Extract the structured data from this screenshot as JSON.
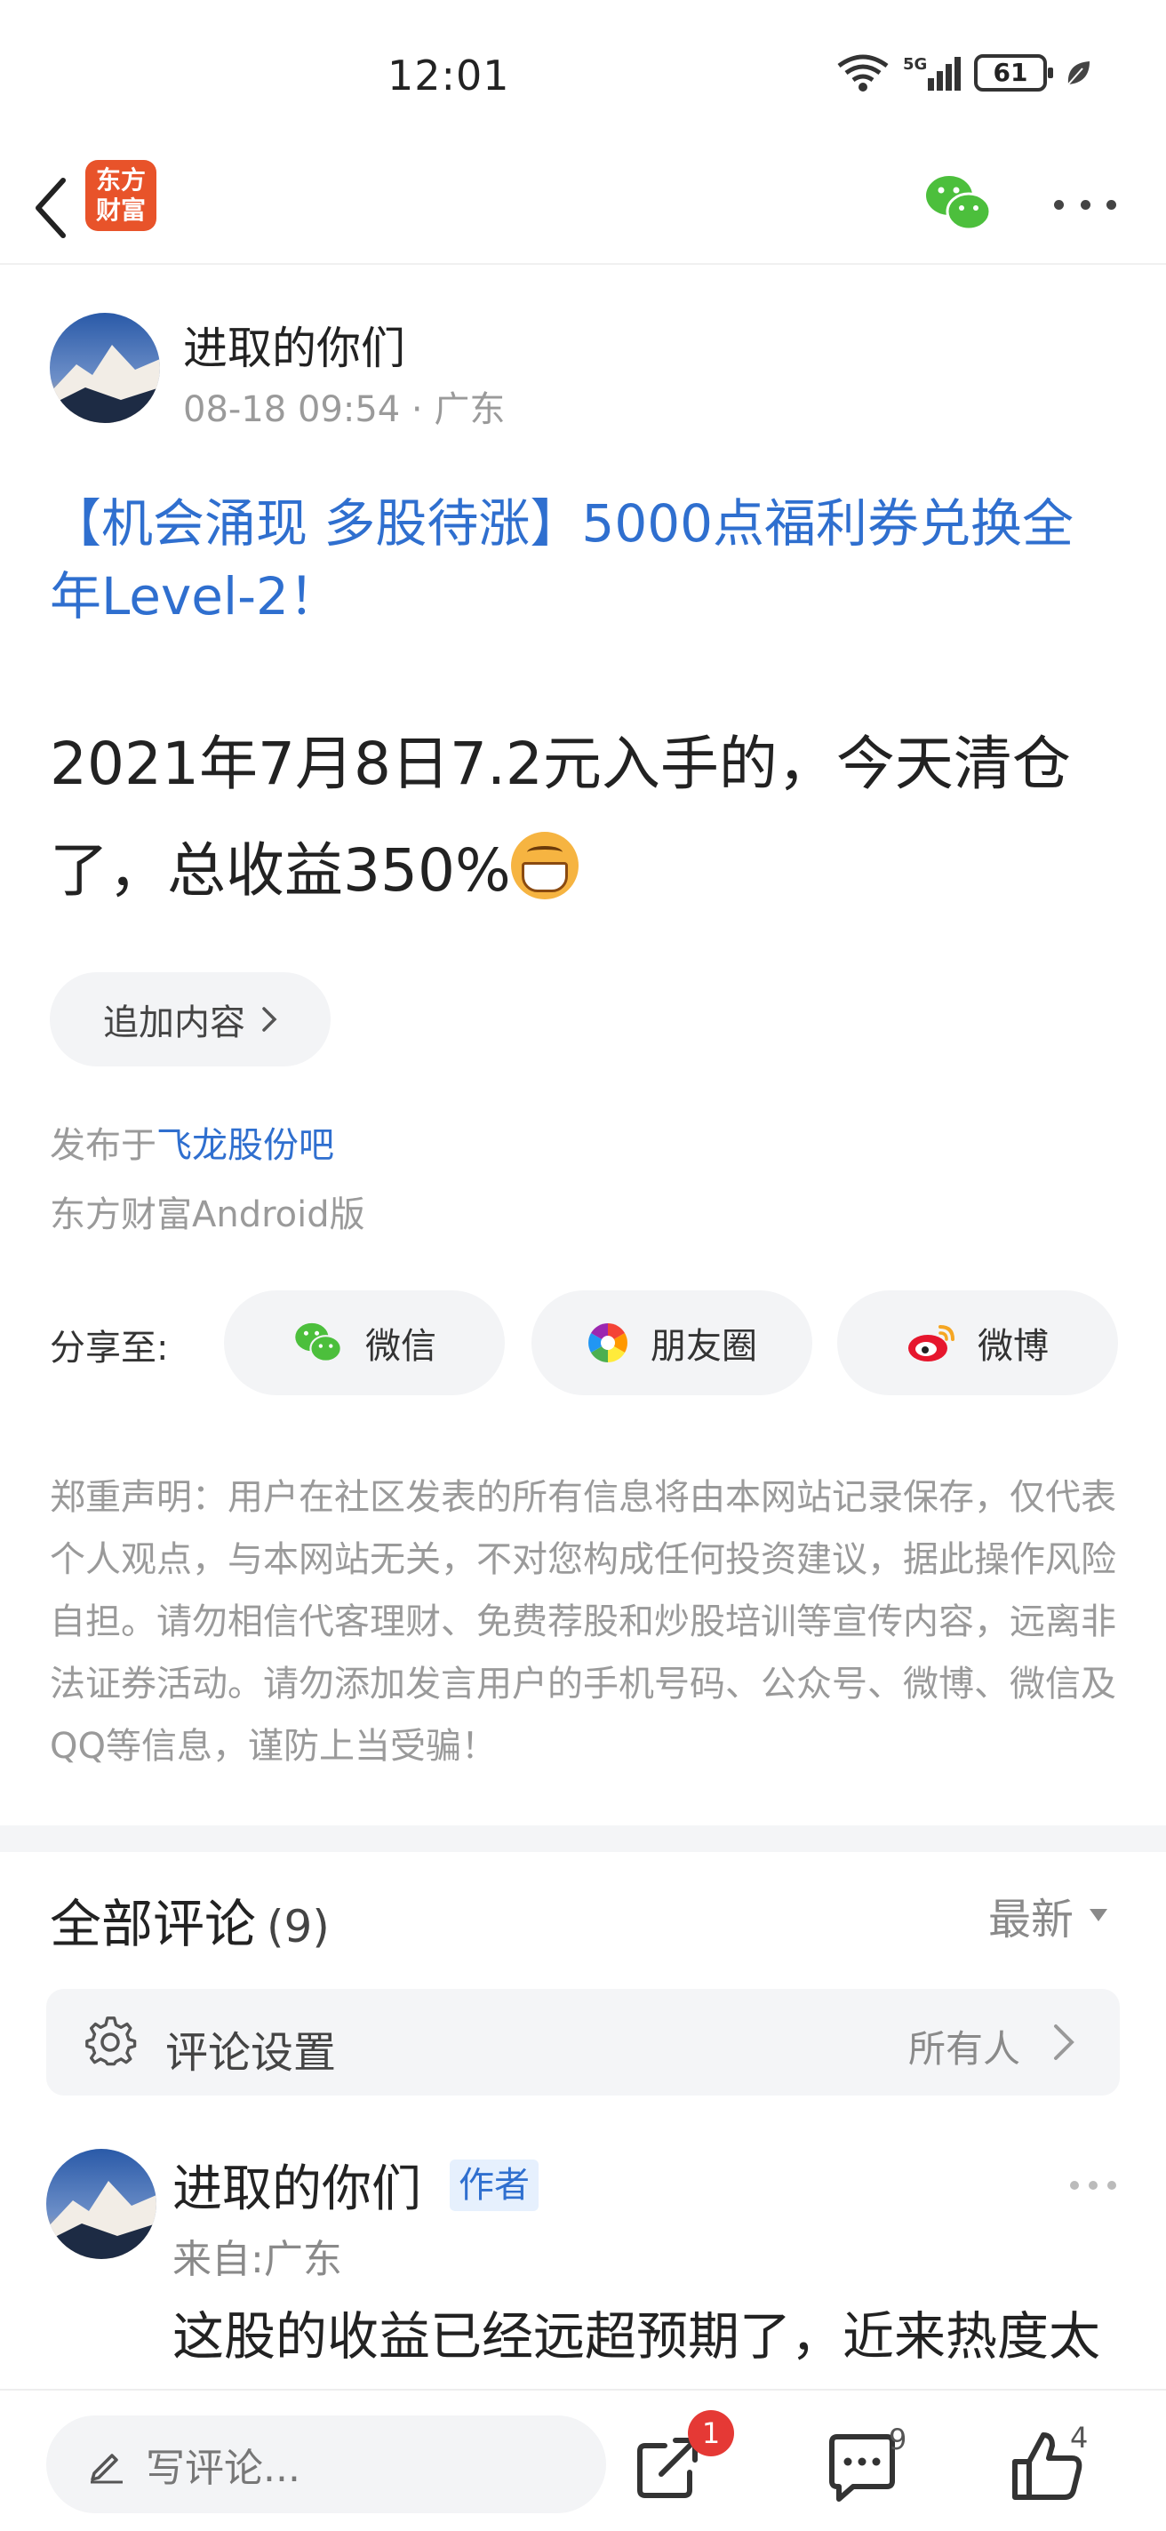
{
  "status": {
    "time": "12:01",
    "network": "5G",
    "battery": "61"
  },
  "header": {
    "logo_line1": "东方",
    "logo_line2": "财富"
  },
  "post": {
    "author": "进取的你们",
    "meta": "08-18 09:54 · 广东",
    "promo": "【机会涌现 多股待涨】5000点福利券兑换全年Level-2！",
    "content": "2021年7月8日7.2元入手的，今天清仓了，总收益350%",
    "append_label": "追加内容",
    "publish_prefix": "发布于",
    "bar_name": "飞龙股份吧",
    "client": "东方财富Android版"
  },
  "share": {
    "label": "分享至:",
    "wechat": "微信",
    "moments": "朋友圈",
    "weibo": "微博"
  },
  "disclaimer": "郑重声明：用户在社区发表的所有信息将由本网站记录保存，仅代表个人观点，与本网站无关，不对您构成任何投资建议，据此操作风险自担。请勿相信代客理财、免费荐股和炒股培训等宣传内容，远离非法证券活动。请勿添加发言用户的手机号码、公众号、微博、微信及QQ等信息，谨防上当受骗！",
  "comments": {
    "title": "全部评论",
    "count": "(9)",
    "sort": "最新",
    "settings_label": "评论设置",
    "settings_value": "所有人",
    "items": [
      {
        "author": "进取的你们",
        "badge": "作者",
        "from": "来自:广东",
        "text": "这股的收益已经远超预期了，近来热度太"
      }
    ]
  },
  "bottom": {
    "placeholder": "写评论...",
    "share_badge": "1",
    "comment_count": "9",
    "like_count": "4"
  },
  "colors": {
    "link_blue": "#2f6fcf",
    "logo_orange": "#e8532a",
    "badge_red": "#e53935",
    "wechat_green": "#4cbf3c"
  }
}
